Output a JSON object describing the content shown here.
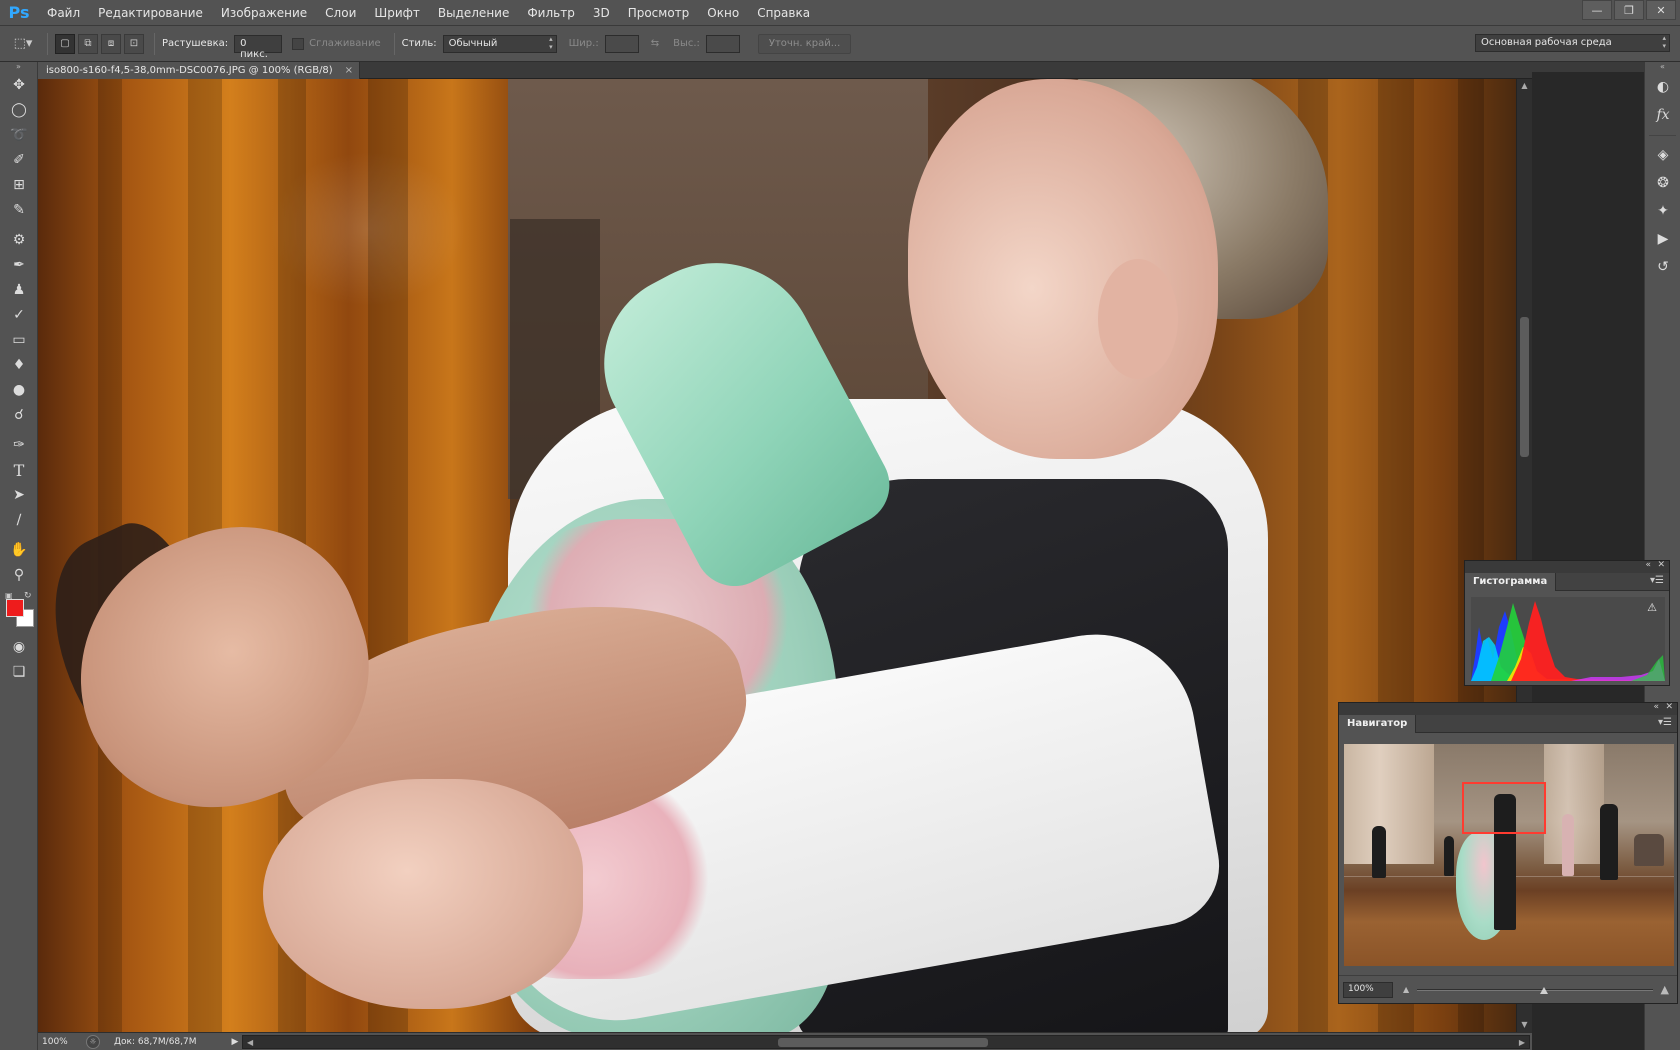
{
  "app": {
    "logo": "Ps",
    "menu": [
      "Файл",
      "Редактирование",
      "Изображение",
      "Слои",
      "Шрифт",
      "Выделение",
      "Фильтр",
      "3D",
      "Просмотр",
      "Окно",
      "Справка"
    ],
    "window_controls": [
      "minimize-icon",
      "restore-icon",
      "close-icon"
    ]
  },
  "options": {
    "feather_label": "Растушевка:",
    "feather_value": "0 пикс.",
    "antialias_label": "Сглаживание",
    "style_label": "Стиль:",
    "style_value": "Обычный",
    "width_label": "Шир.:",
    "height_label": "Выс.:",
    "refine_button": "Уточн. край...",
    "workspace_value": "Основная рабочая среда"
  },
  "document": {
    "tab_title": "iso800-s160-f4,5-38,0mm-DSC0076.JPG @ 100% (RGB/8)",
    "close_glyph": "×"
  },
  "colors": {
    "foreground": "#ee1c1c",
    "background": "#ffffff",
    "app_accent": "#31a8ff",
    "navigator_view_box": "#ff3b30"
  },
  "status": {
    "zoom": "100%",
    "doc_size": "Док: 68,7M/68,7M"
  },
  "histogram": {
    "title": "Гистограмма"
  },
  "navigator": {
    "title": "Навигатор",
    "zoom": "100%"
  },
  "tools": [
    "move-tool",
    "marquee-tool",
    "lasso-tool",
    "quick-selection-tool",
    "crop-tool",
    "eyedropper-tool",
    "healing-brush-tool",
    "brush-tool",
    "clone-stamp-tool",
    "history-brush-tool",
    "eraser-tool",
    "paint-bucket-tool",
    "blur-tool",
    "dodge-tool",
    "pen-tool",
    "type-tool",
    "path-selection-tool",
    "line-tool",
    "hand-tool",
    "zoom-tool"
  ],
  "right_dock": [
    "color-panel-icon",
    "styles-panel-icon",
    "layers-panel-icon",
    "channels-panel-icon",
    "paths-panel-icon",
    "actions-panel-icon",
    "history-panel-icon"
  ]
}
